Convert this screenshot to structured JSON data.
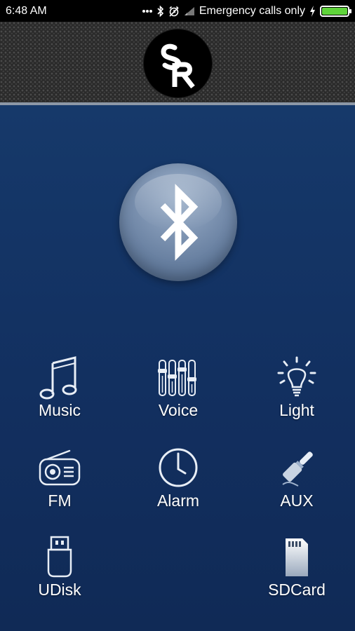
{
  "status_bar": {
    "time": "6:48 AM",
    "network_text": "Emergency calls only",
    "icons": [
      "more-dots-icon",
      "bluetooth-icon",
      "alarm-icon",
      "signal-icon",
      "charging-icon",
      "battery-icon"
    ]
  },
  "header": {
    "logo_letters": "SR"
  },
  "bluetooth": {
    "icon": "bluetooth-icon"
  },
  "grid": {
    "music": {
      "label": "Music",
      "icon": "music-note-icon"
    },
    "voice": {
      "label": "Voice",
      "icon": "equalizer-icon"
    },
    "light": {
      "label": "Light",
      "icon": "light-bulb-icon"
    },
    "fm": {
      "label": "FM",
      "icon": "radio-icon"
    },
    "alarm": {
      "label": "Alarm",
      "icon": "clock-icon"
    },
    "aux": {
      "label": "AUX",
      "icon": "audio-jack-icon"
    },
    "udisk": {
      "label": "UDisk",
      "icon": "usb-drive-icon"
    },
    "sdcard": {
      "label": "SDCard",
      "icon": "sd-card-icon"
    }
  },
  "colors": {
    "background": "#143566",
    "header_mesh": "#2a2a2a",
    "battery_fill": "#5fd33a",
    "text": "#ffffff"
  }
}
